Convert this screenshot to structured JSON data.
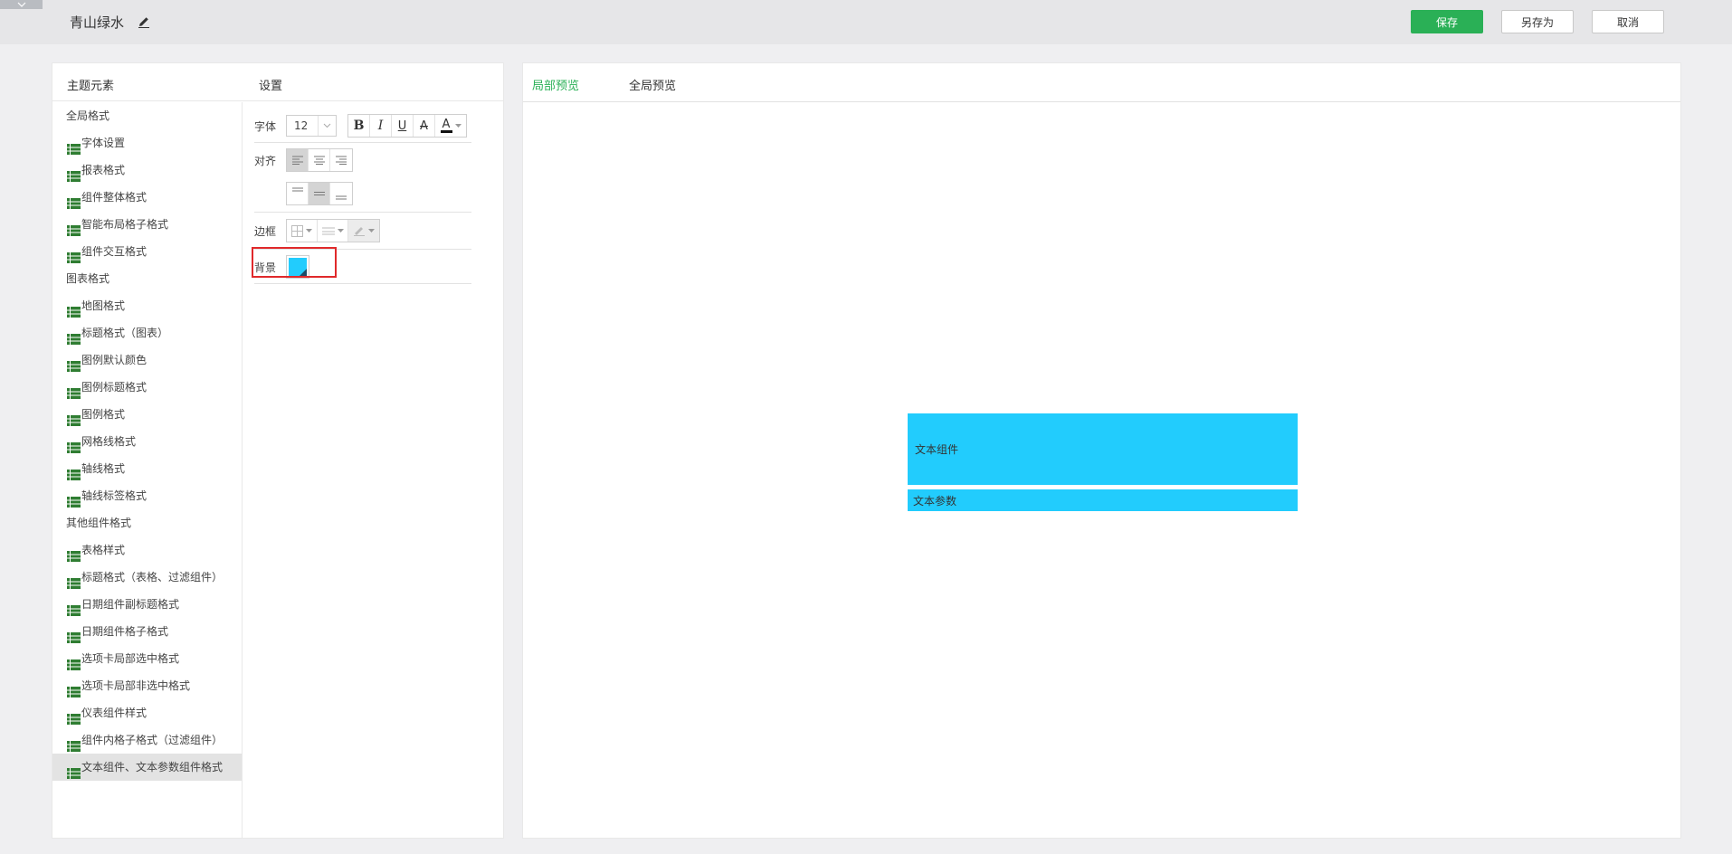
{
  "header": {
    "theme_name": "青山绿水",
    "save_label": "保存",
    "save_as_label": "另存为",
    "cancel_label": "取消",
    "accent_color": "#2ab056"
  },
  "left_panel": {
    "elements_header": "主题元素",
    "settings_header": "设置",
    "items": [
      {
        "label": "全局格式",
        "type": "group"
      },
      {
        "label": "字体设置",
        "type": "item"
      },
      {
        "label": "报表格式",
        "type": "item"
      },
      {
        "label": "组件整体格式",
        "type": "item"
      },
      {
        "label": "智能布局格子格式",
        "type": "item"
      },
      {
        "label": "组件交互格式",
        "type": "item"
      },
      {
        "label": "图表格式",
        "type": "group"
      },
      {
        "label": "地图格式",
        "type": "item"
      },
      {
        "label": "标题格式（图表）",
        "type": "item"
      },
      {
        "label": "图例默认颜色",
        "type": "item"
      },
      {
        "label": "图例标题格式",
        "type": "item"
      },
      {
        "label": "图例格式",
        "type": "item"
      },
      {
        "label": "网格线格式",
        "type": "item"
      },
      {
        "label": "轴线格式",
        "type": "item"
      },
      {
        "label": "轴线标签格式",
        "type": "item"
      },
      {
        "label": "其他组件格式",
        "type": "group"
      },
      {
        "label": "表格样式",
        "type": "item"
      },
      {
        "label": "标题格式（表格、过滤组件）",
        "type": "item"
      },
      {
        "label": "日期组件副标题格式",
        "type": "item"
      },
      {
        "label": "日期组件格子格式",
        "type": "item"
      },
      {
        "label": "选项卡局部选中格式",
        "type": "item"
      },
      {
        "label": "选项卡局部非选中格式",
        "type": "item"
      },
      {
        "label": "仪表组件样式",
        "type": "item"
      },
      {
        "label": "组件内格子格式（过滤组件）",
        "type": "item"
      },
      {
        "label": "文本组件、文本参数组件格式",
        "type": "item",
        "selected": true
      }
    ]
  },
  "settings": {
    "font_label": "字体",
    "font_size": "12",
    "align_label": "对齐",
    "border_label": "边框",
    "background_label": "背景",
    "background_color": "#22ccfd",
    "bold_glyph": "B",
    "italic_glyph": "I",
    "underline_glyph": "U",
    "strike_glyph": "A",
    "font_color_glyph": "A"
  },
  "preview": {
    "tab_local": "局部预览",
    "tab_global": "全局预览",
    "text_component": "文本组件",
    "text_param": "文本参数"
  }
}
